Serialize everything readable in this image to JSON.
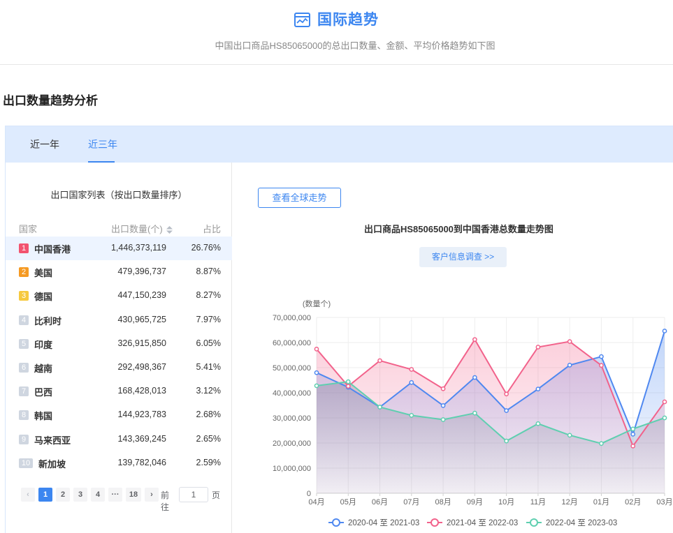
{
  "header": {
    "title": "国际趋势",
    "subtitle": "中国出口商品HS85065000的总出口数量、金额、平均价格趋势如下图"
  },
  "section_title": "出口数量趋势分析",
  "tabs": [
    {
      "label": "近一年",
      "active": false
    },
    {
      "label": "近三年",
      "active": true
    }
  ],
  "country_list": {
    "title": "出口国家列表（按出口数量排序）",
    "columns": {
      "country": "国家",
      "quantity": "出口数量(个)",
      "share": "占比"
    },
    "rows": [
      {
        "rank": "1",
        "name": "中国香港",
        "quantity": "1,446,373,119",
        "share": "26.76%",
        "color": "#f2536e"
      },
      {
        "rank": "2",
        "name": "美国",
        "quantity": "479,396,737",
        "share": "8.87%",
        "color": "#f59a23"
      },
      {
        "rank": "3",
        "name": "德国",
        "quantity": "447,150,239",
        "share": "8.27%",
        "color": "#f6c93f"
      },
      {
        "rank": "4",
        "name": "比利时",
        "quantity": "430,965,725",
        "share": "7.97%",
        "color": "#cfd6e0"
      },
      {
        "rank": "5",
        "name": "印度",
        "quantity": "326,915,850",
        "share": "6.05%",
        "color": "#cfd6e0"
      },
      {
        "rank": "6",
        "name": "越南",
        "quantity": "292,498,367",
        "share": "5.41%",
        "color": "#cfd6e0"
      },
      {
        "rank": "7",
        "name": "巴西",
        "quantity": "168,428,013",
        "share": "3.12%",
        "color": "#cfd6e0"
      },
      {
        "rank": "8",
        "name": "韩国",
        "quantity": "144,923,783",
        "share": "2.68%",
        "color": "#cfd6e0"
      },
      {
        "rank": "9",
        "name": "马来西亚",
        "quantity": "143,369,245",
        "share": "2.65%",
        "color": "#cfd6e0"
      },
      {
        "rank": "10",
        "name": "新加坡",
        "quantity": "139,782,046",
        "share": "2.59%",
        "color": "#cfd6e0"
      }
    ]
  },
  "pagination": {
    "prev": "‹",
    "pages": [
      "1",
      "2",
      "3",
      "4",
      "···",
      "18"
    ],
    "next": "›",
    "goto_label": "前往",
    "goto_value": "1",
    "page_suffix": "页"
  },
  "buttons": {
    "global_trend": "查看全球走势",
    "survey": "客户信息调查 >>"
  },
  "chart_data": {
    "type": "area",
    "title": "出口商品HS85065000到中国香港总数量走势图",
    "ylabel": "(数量个)",
    "xlabel": "",
    "ylim": [
      0,
      70000000
    ],
    "yticks": [
      "0",
      "10,000,000",
      "20,000,000",
      "30,000,000",
      "40,000,000",
      "50,000,000",
      "60,000,000",
      "70,000,000"
    ],
    "categories": [
      "04月",
      "05月",
      "06月",
      "07月",
      "08月",
      "09月",
      "10月",
      "11月",
      "12月",
      "01月",
      "02月",
      "03月"
    ],
    "grid": true,
    "legend_position": "bottom",
    "series": [
      {
        "name": "2020-04 至 2021-03",
        "color": "#4f88f0",
        "values": [
          48000000,
          42200000,
          34300000,
          44100000,
          34900000,
          46100000,
          32900000,
          41500000,
          51000000,
          54400000,
          23500000,
          64600000
        ]
      },
      {
        "name": "2021-04 至 2022-03",
        "color": "#f2628b",
        "values": [
          57400000,
          42600000,
          52800000,
          49300000,
          41600000,
          61200000,
          39500000,
          58200000,
          60400000,
          50900000,
          18800000,
          36400000
        ]
      },
      {
        "name": "2022-04 至 2023-03",
        "color": "#5fcfb0",
        "values": [
          42800000,
          44400000,
          34300000,
          31000000,
          29300000,
          31900000,
          20800000,
          27700000,
          23100000,
          19800000,
          25600000,
          30000000
        ]
      }
    ]
  }
}
